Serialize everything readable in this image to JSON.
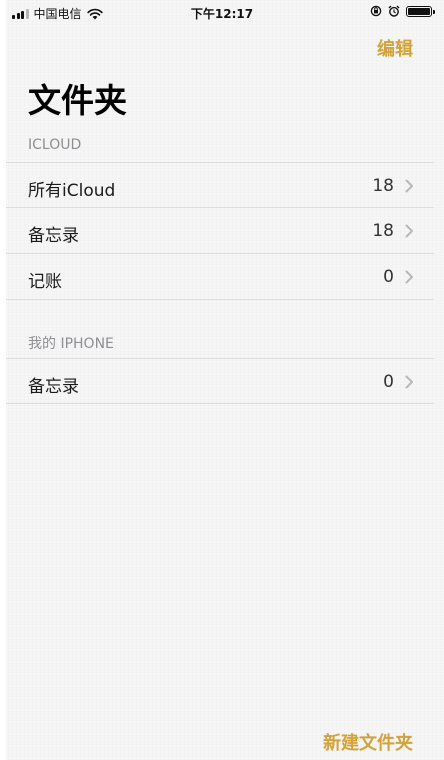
{
  "status_bar": {
    "carrier": "中国电信",
    "time": "下午12:17",
    "battery_level": 1.0
  },
  "nav": {
    "edit_label": "编辑"
  },
  "title": "文件夹",
  "sections": [
    {
      "header": "ICLOUD",
      "items": [
        {
          "label": "所有iCloud",
          "count": "18"
        },
        {
          "label": "备忘录",
          "count": "18"
        },
        {
          "label": "记账",
          "count": "0"
        }
      ]
    },
    {
      "header": "我的 IPHONE",
      "items": [
        {
          "label": "备忘录",
          "count": "0"
        }
      ]
    }
  ],
  "toolbar": {
    "new_folder_label": "新建文件夹"
  },
  "colors": {
    "accent": "#d4a23a",
    "background": "#f6f6f6",
    "separator": "#dcdcdc",
    "section_header": "#8e8e93"
  }
}
